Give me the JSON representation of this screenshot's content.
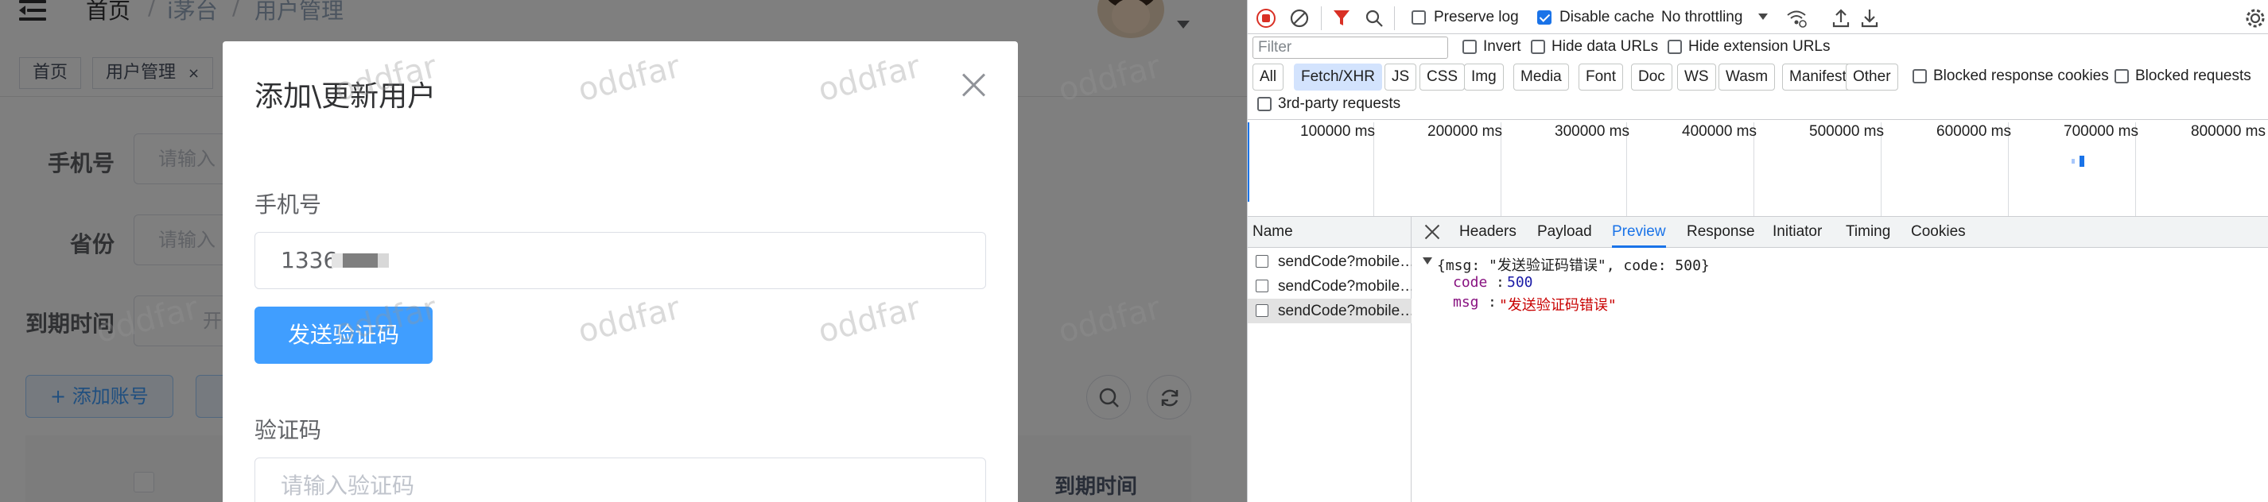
{
  "app": {
    "breadcrumb": [
      "首页",
      "i茅台",
      "用户管理"
    ],
    "breadcrumb_sep": "/",
    "tags": [
      {
        "label": "首页"
      },
      {
        "label": "用户管理",
        "close": "×"
      }
    ],
    "filters": {
      "phone_label": "手机号",
      "phone_placeholder": "请输入",
      "province_label": "省份",
      "province_placeholder": "请输入",
      "expire_label": "到期时间",
      "expire_start": "开"
    },
    "add_button": "+ 添加账号",
    "table": {
      "expire_header": "到期时间"
    },
    "watermark": "oddfar",
    "modal": {
      "title": "添加\\更新用户",
      "phone_label": "手机号",
      "phone_value": "1336",
      "send_code": "发送验证码",
      "code_label": "验证码",
      "code_placeholder": "请输入验证码"
    }
  },
  "devtools": {
    "toolbar": {
      "preserve_log": "Preserve log",
      "preserve_log_checked": false,
      "disable_cache": "Disable cache",
      "disable_cache_checked": true,
      "throttling": "No throttling"
    },
    "filter_placeholder": "Filter",
    "invert": "Invert",
    "hide_data_urls": "Hide data URLs",
    "hide_extension_urls": "Hide extension URLs",
    "type_filters": [
      "All",
      "Fetch/XHR",
      "JS",
      "CSS",
      "Img",
      "Media",
      "Font",
      "Doc",
      "WS",
      "Wasm",
      "Manifest",
      "Other"
    ],
    "type_selected": "Fetch/XHR",
    "blocked_cookies": "Blocked response cookies",
    "blocked_requests": "Blocked requests",
    "third_party": "3rd-party requests",
    "timeline_labels": [
      "100000 ms",
      "200000 ms",
      "300000 ms",
      "400000 ms",
      "500000 ms",
      "600000 ms",
      "700000 ms",
      "800000 ms"
    ],
    "name_header": "Name",
    "requests": [
      "sendCode?mobile…",
      "sendCode?mobile…",
      "sendCode?mobile…"
    ],
    "tabs": [
      "Headers",
      "Payload",
      "Preview",
      "Response",
      "Initiator",
      "Timing",
      "Cookies"
    ],
    "active_tab": "Preview",
    "preview": {
      "summary": "{msg: \"发送验证码错误\", code: 500}",
      "code_key": "code",
      "code_value": "500",
      "msg_key": "msg",
      "msg_value": "\"发送验证码错误\""
    },
    "colors": {
      "accent": "#1a73e8",
      "record": "#d93025",
      "filter": "#d93025"
    }
  }
}
